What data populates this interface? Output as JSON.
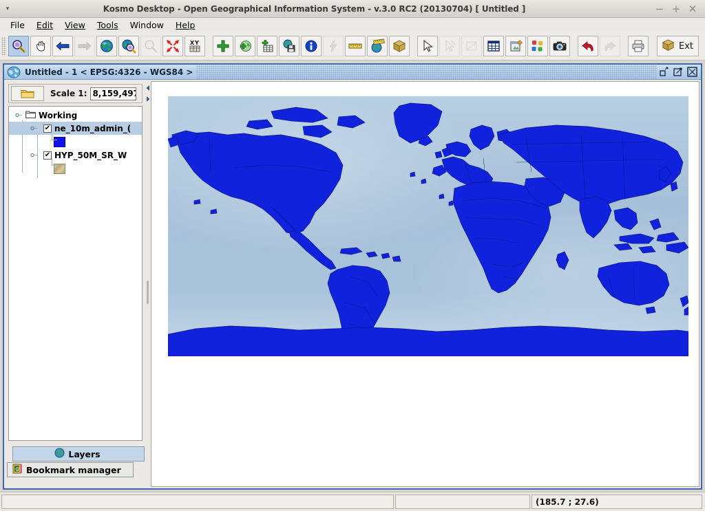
{
  "window": {
    "title": "Kosmo Desktop - Open Geographical Information System - v.3.0 RC2 (20130704)  [ Untitled ]",
    "menu_arrow": "▾",
    "controls": {
      "minimize": "−",
      "maximize": "+",
      "close": "✕"
    }
  },
  "menubar": {
    "items": [
      {
        "label": "File",
        "mnemonic": "F"
      },
      {
        "label": "Edit",
        "mnemonic": "E"
      },
      {
        "label": "View",
        "mnemonic": "V"
      },
      {
        "label": "Tools",
        "mnemonic": "T"
      },
      {
        "label": "Window",
        "mnemonic": ""
      },
      {
        "label": "Help",
        "mnemonic": "H"
      }
    ]
  },
  "toolbar": {
    "groups": [
      {
        "buttons": [
          {
            "icon": "zoom-in-icon",
            "state": "selected"
          },
          {
            "icon": "pan-hand-icon",
            "state": "normal"
          },
          {
            "icon": "back-arrow-icon",
            "state": "normal"
          },
          {
            "icon": "forward-arrow-icon",
            "state": "disabled"
          },
          {
            "icon": "zoom-full-extent-icon",
            "state": "normal"
          },
          {
            "icon": "zoom-layer-icon",
            "state": "normal"
          },
          {
            "icon": "zoom-selected-icon",
            "state": "disabled"
          },
          {
            "icon": "zoom-fit-icon",
            "state": "normal"
          },
          {
            "icon": "goto-xy-icon",
            "state": "normal"
          }
        ]
      },
      {
        "buttons": [
          {
            "icon": "add-layer-icon",
            "state": "normal"
          },
          {
            "icon": "add-wms-layer-icon",
            "state": "normal"
          },
          {
            "icon": "add-table-icon",
            "state": "normal"
          },
          {
            "icon": "save-layer-icon",
            "state": "normal"
          },
          {
            "icon": "info-icon",
            "state": "normal"
          },
          {
            "icon": "lightning-icon",
            "state": "disabled"
          },
          {
            "icon": "measure-ruler-icon",
            "state": "normal"
          },
          {
            "icon": "measure-area-icon",
            "state": "normal"
          },
          {
            "icon": "package-3d-icon",
            "state": "normal"
          }
        ]
      },
      {
        "buttons": [
          {
            "icon": "select-cursor-icon",
            "state": "normal"
          },
          {
            "icon": "deselect-cursor-icon",
            "state": "disabled"
          },
          {
            "icon": "edit-geometry-icon",
            "state": "disabled"
          },
          {
            "icon": "attribute-table-icon",
            "state": "normal"
          },
          {
            "icon": "new-view-icon",
            "state": "normal"
          },
          {
            "icon": "symbology-icon",
            "state": "normal"
          },
          {
            "icon": "camera-snapshot-icon",
            "state": "normal"
          }
        ]
      },
      {
        "buttons": [
          {
            "icon": "undo-icon",
            "state": "normal"
          },
          {
            "icon": "redo-icon",
            "state": "disabled"
          }
        ]
      },
      {
        "buttons": [
          {
            "icon": "print-icon",
            "state": "normal"
          }
        ]
      }
    ],
    "ext_button": {
      "label": "Ext",
      "icon": "package-box-icon"
    }
  },
  "internal_frame": {
    "title": "Untitled - 1 < EPSG:4326 - WGS84 >",
    "icon": "globe-icon",
    "controls": {
      "restore": "restore-icon",
      "maximize": "maximize-icon",
      "close": "close-icon"
    }
  },
  "scale_panel": {
    "folder_button_icon": "folder-icon",
    "label": "Scale 1:",
    "value": "8,159,497"
  },
  "layer_tree": {
    "nodes": [
      {
        "label": "Working",
        "icon": "folder-open-icon",
        "expanded": true,
        "type": "group",
        "indent": 0,
        "checkbox": null,
        "selected": false
      },
      {
        "label": "ne_10m_admin_(",
        "type": "vector-layer",
        "indent": 1,
        "expanded": true,
        "checkbox": "checked",
        "check_glyph": "✔",
        "selected": true
      },
      {
        "label": "",
        "type": "swatch",
        "swatch": "solid-blue",
        "color": "#1010e8",
        "indent": 2,
        "selected": false
      },
      {
        "label": "HYP_50M_SR_W",
        "type": "raster-layer",
        "indent": 1,
        "expanded": true,
        "checkbox": "checked",
        "check_glyph": "✔",
        "selected": false
      },
      {
        "label": "",
        "type": "swatch",
        "swatch": "raster-thumbnail",
        "indent": 2,
        "selected": false
      }
    ]
  },
  "panel_tabs": [
    {
      "label": "Layers",
      "icon": "globe-icon",
      "selected": true
    },
    {
      "label": "Bookmark manager",
      "icon": "bookmark-icon",
      "selected": false
    }
  ],
  "statusbar": {
    "left_message": "",
    "middle_message": "",
    "coordinates": "(185.7 ; 27.6)"
  },
  "colors": {
    "land": "#1122dd",
    "land_border": "#0c1a86",
    "ocean": "#a9c3db",
    "frame_accent": "#4169b0",
    "selection": "#b8cde2",
    "tab_selected": "#c3d6ea",
    "toolbar_selected": "#b6cee6"
  },
  "map": {
    "projection": "EPSG:4326 - WGS84",
    "layers_rendered": [
      "HYP_50M_SR_W",
      "ne_10m_admin_("
    ]
  }
}
